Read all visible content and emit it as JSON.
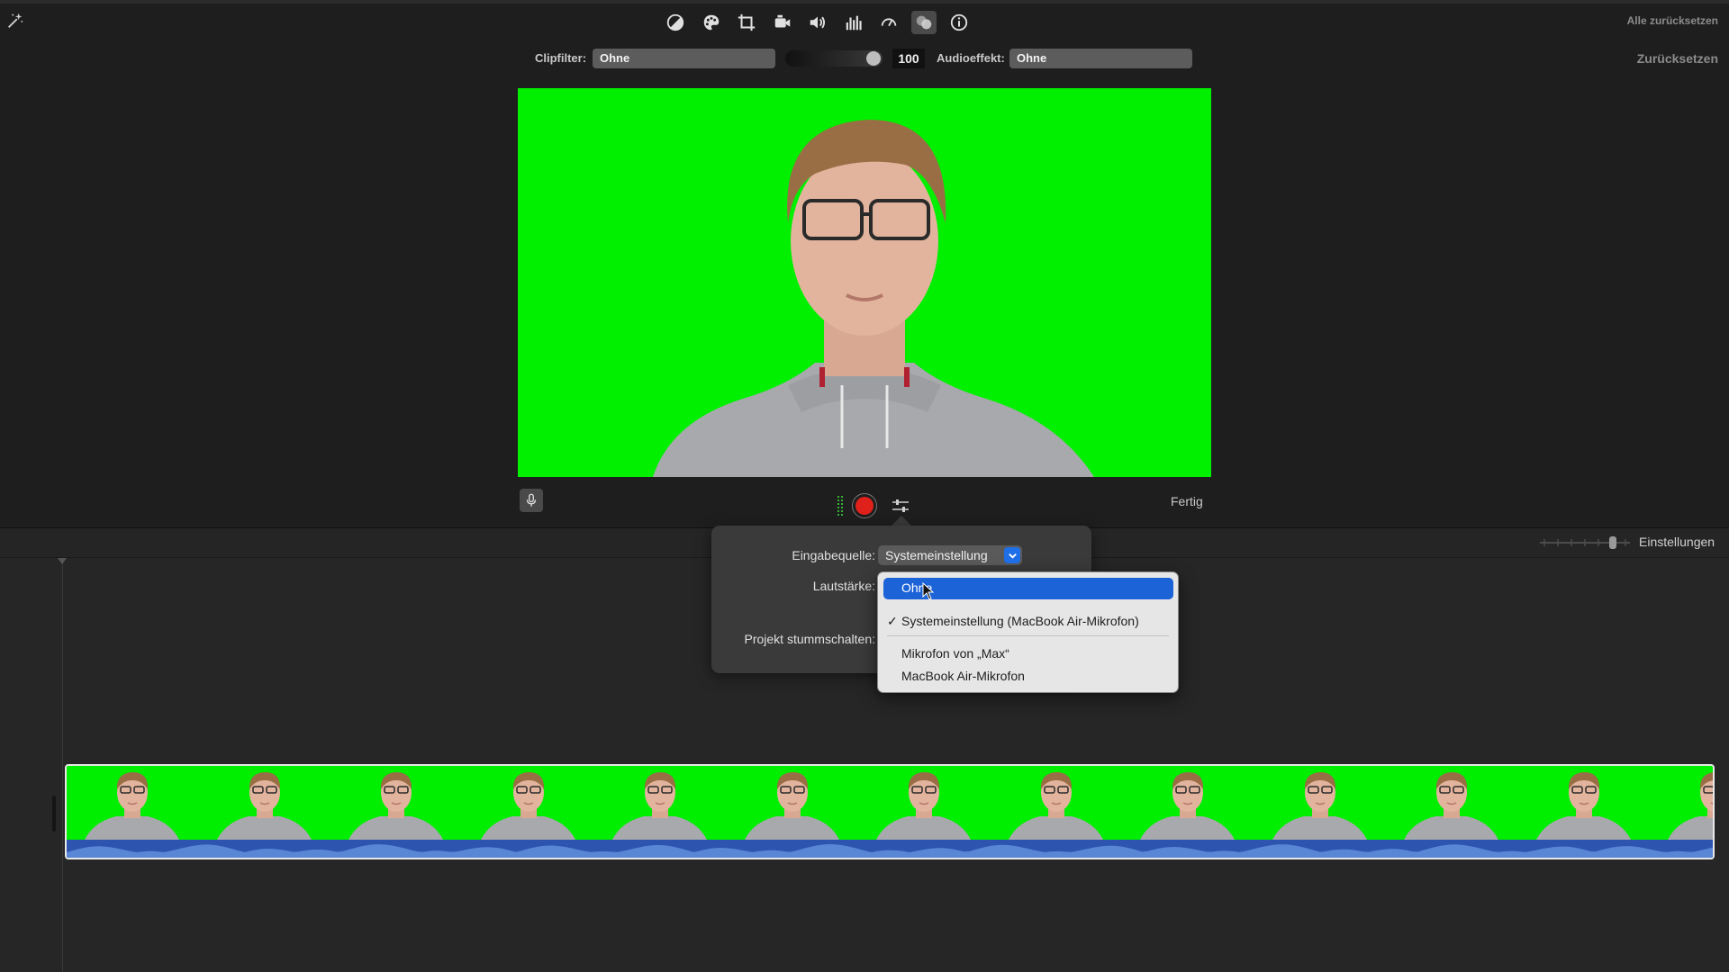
{
  "toolbar": {
    "reset_all": "Alle zurücksetzen",
    "reset": "Zurücksetzen",
    "icons": [
      "magic-wand-icon",
      "color-balance-icon",
      "color-correction-icon",
      "crop-icon",
      "stabilization-icon",
      "volume-icon",
      "equalizer-icon",
      "speed-icon",
      "overlay-icon",
      "info-icon"
    ]
  },
  "filters": {
    "clip_filter_label": "Clipfilter:",
    "clip_filter_value": "Ohne",
    "amount": "100",
    "audio_effect_label": "Audioeffekt:",
    "audio_effect_value": "Ohne"
  },
  "voiceover": {
    "done": "Fertig"
  },
  "timeline": {
    "settings": "Einstellungen"
  },
  "popover": {
    "input_source_label": "Eingabequelle:",
    "input_source_value": "Systemeinstellung",
    "volume_label": "Lautstärke:",
    "mute_label": "Projekt stummschalten:"
  },
  "dropdown": {
    "items": [
      {
        "label": "Ohne",
        "highlighted": true
      },
      {
        "label": "Systemeinstellung (MacBook Air-Mikrofon)",
        "checked": true
      },
      {
        "label": "Mikrofon von „Max“"
      },
      {
        "label": "MacBook Air-Mikrofon"
      }
    ]
  },
  "colors": {
    "green_screen": "#00f000",
    "accent": "#1d63d8",
    "record": "#e0201a"
  }
}
